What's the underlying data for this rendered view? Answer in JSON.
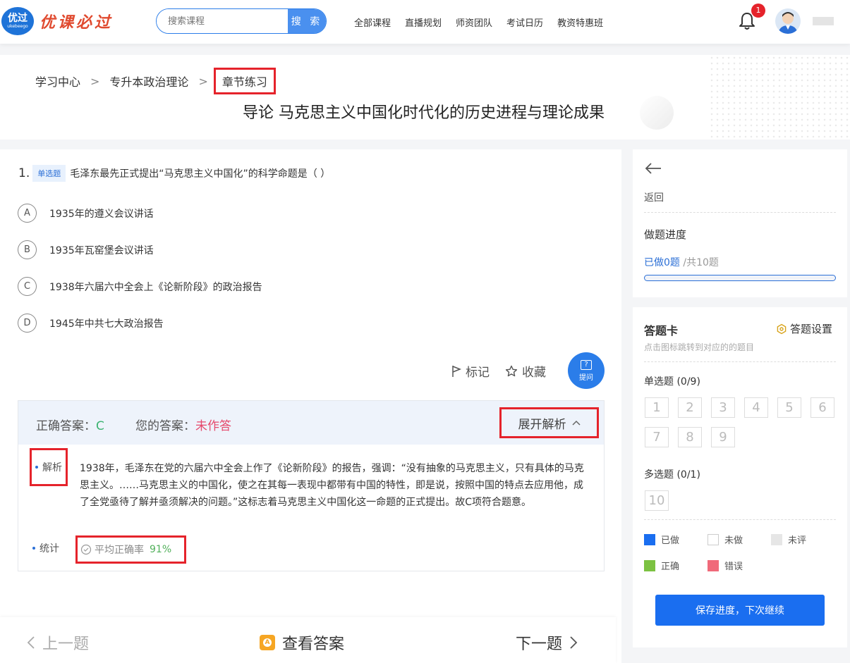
{
  "header": {
    "logo_badge": "优过",
    "logo_badge_sub": "ukebeego",
    "logo_text": "优课必过",
    "search_placeholder": "搜索课程",
    "search_button": "搜 索",
    "nav": [
      "全部课程",
      "直播规划",
      "师资团队",
      "考试日历",
      "教资特惠班"
    ],
    "notification_count": "1"
  },
  "breadcrumb": {
    "items": [
      "学习中心",
      "专升本政治理论",
      "章节练习"
    ],
    "separator": ">"
  },
  "page_title": "导论 马克思主义中国化时代化的历史进程与理论成果",
  "question": {
    "number": "1.",
    "type": "单选题",
    "text": "毛泽东最先正式提出“马克思主义中国化”的科学命题是（ ）",
    "options": [
      {
        "letter": "A",
        "text": "1935年的遵义会议讲话"
      },
      {
        "letter": "B",
        "text": "1935年瓦窑堡会议讲话"
      },
      {
        "letter": "C",
        "text": "1938年六届六中全会上《论新阶段》的政治报告"
      },
      {
        "letter": "D",
        "text": "1945年中共七大政治报告"
      }
    ]
  },
  "actions": {
    "mark": "标记",
    "favorite": "收藏",
    "ask": "提问"
  },
  "answer": {
    "correct_label": "正确答案：",
    "correct_value": "C",
    "yours_label": "您的答案：",
    "yours_value": "未作答",
    "expand": "展开解析",
    "analysis_label": "解析",
    "analysis_text": "1938年，毛泽东在党的六届六中全会上作了《论新阶段》的报告，强调：“没有抽象的马克思主义，只有具体的马克思主义。……马克思主义的中国化，使之在其每一表现中都带有中国的特性，即是说，按照中国的特点去应用他，成了全党亟待了解并亟须解决的问题。”这标志着马克思主义中国化这一命题的正式提出。故C项符合题意。",
    "stats_label": "统计",
    "avg_label": "平均正确率",
    "avg_value": "91%"
  },
  "bottom_nav": {
    "prev": "上一题",
    "view_answer": "查看答案",
    "next": "下一题"
  },
  "sidebar": {
    "back": "返回",
    "progress_title": "做题进度",
    "progress_done": "已做0题",
    "progress_total": "/共10题",
    "progress_fraction": 0,
    "card_title": "答题卡",
    "card_settings": "答题设置",
    "card_hint": "点击图标跳转到对应的的题目",
    "single_title": "单选题 (0/9)",
    "single_numbers": [
      "1",
      "2",
      "3",
      "4",
      "5",
      "6",
      "7",
      "8",
      "9"
    ],
    "multi_title": "多选题 (0/1)",
    "multi_numbers": [
      "10"
    ],
    "legend": [
      {
        "label": "已做",
        "color": "#1a6ef0"
      },
      {
        "label": "未做",
        "color": "#ffffff"
      },
      {
        "label": "未评",
        "color": "#e6e6e6"
      },
      {
        "label": "正确",
        "color": "#7cc242"
      },
      {
        "label": "错误",
        "color": "#f06a7a"
      }
    ],
    "save_button": "保存进度，下次继续"
  }
}
